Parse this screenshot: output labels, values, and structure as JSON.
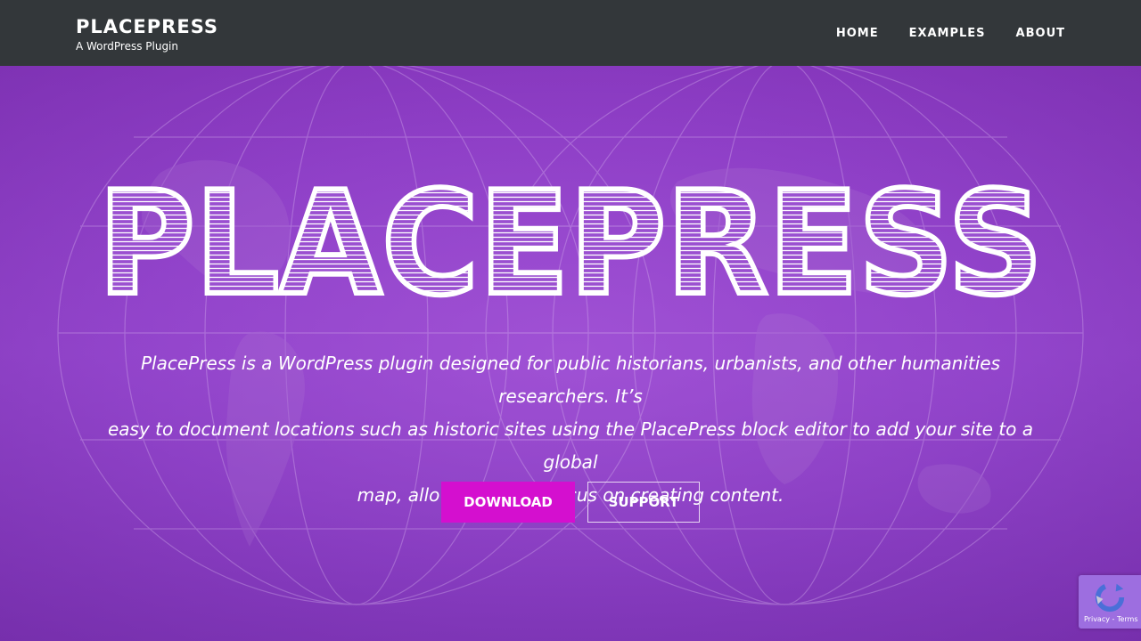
{
  "header": {
    "site_title": "PLACEPRESS",
    "tagline": "A WordPress Plugin",
    "nav": [
      {
        "label": "HOME"
      },
      {
        "label": "EXAMPLES"
      },
      {
        "label": "ABOUT"
      }
    ]
  },
  "hero": {
    "logo_text": "PLACEPRESS",
    "description_lines": [
      "PlacePress is a WordPress plugin designed for public historians, urbanists, and other humanities researchers. It’s",
      "easy to document locations such as historic sites using the PlacePress block editor to add your site to a global",
      "map, allowing you to focus on creating content."
    ],
    "buttons": {
      "download_label": "DOWNLOAD",
      "support_label": "SUPPORT"
    }
  },
  "recaptcha": {
    "links_text": "Privacy - Terms",
    "icon": "recaptcha-icon"
  },
  "colors": {
    "header_bg": "#33373a",
    "hero_purple": "#8d3dc4",
    "download_magenta": "#d40fcf"
  }
}
